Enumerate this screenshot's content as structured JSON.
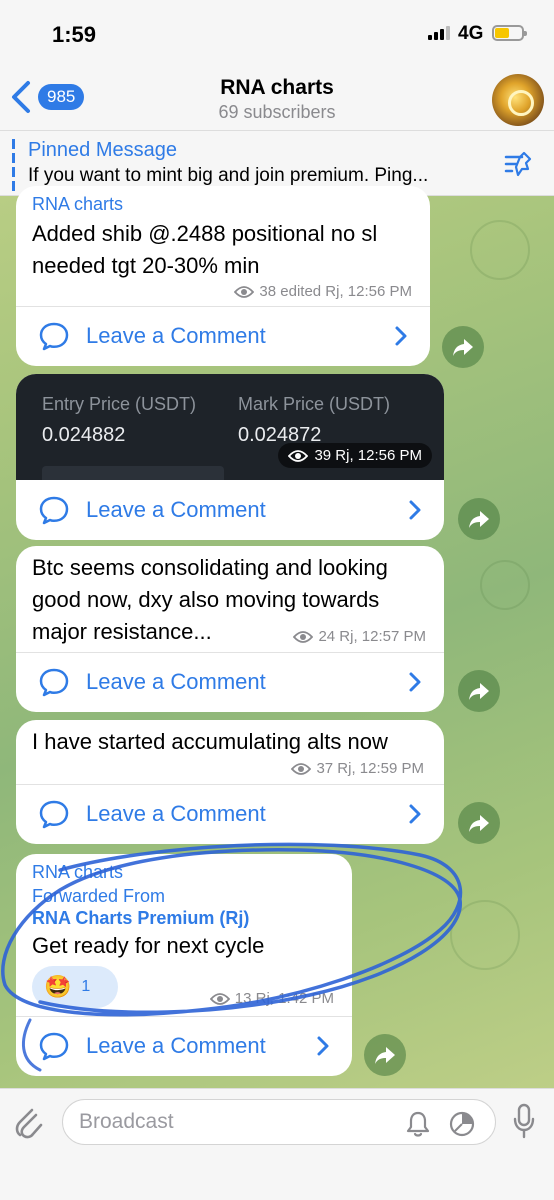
{
  "status_bar": {
    "time": "1:59",
    "network": "4G",
    "battery_level": 0.55
  },
  "header": {
    "back_count": "985",
    "title": "RNA charts",
    "subtitle": "69 subscribers"
  },
  "pinned": {
    "title": "Pinned Message",
    "text": "If you want to mint big and join premium.  Ping..."
  },
  "messages": [
    {
      "sender": "RNA charts",
      "text_lines": [
        "Added shib @.2488 positional no sl",
        "needed tgt 20-30% min"
      ],
      "meta": "38 edited Rj, 12:56 PM",
      "comment_label": "Leave a Comment"
    },
    {
      "card": {
        "entry_label": "Entry Price (USDT)",
        "entry_value": "0.024882",
        "mark_label": "Mark Price (USDT)",
        "mark_value": "0.024872"
      },
      "meta": "39 Rj, 12:56 PM",
      "comment_label": "Leave a Comment"
    },
    {
      "text_lines": [
        "Btc seems consolidating and looking",
        "good now, dxy also moving towards",
        "major resistance..."
      ],
      "meta": "24 Rj, 12:57 PM",
      "comment_label": "Leave a Comment"
    },
    {
      "text_lines": [
        "I have started accumulating alts now"
      ],
      "meta": "37 Rj, 12:59 PM",
      "comment_label": "Leave a Comment"
    },
    {
      "sender": "RNA charts",
      "forwarded_label": "Forwarded From",
      "forwarded_source": "RNA Charts Premium (Rj)",
      "text_lines": [
        "Get ready for next cycle"
      ],
      "reaction": {
        "emoji": "🤩",
        "count": "1"
      },
      "meta": "13 Rj, 1:42 PM",
      "comment_label": "Leave a Comment"
    }
  ],
  "input": {
    "placeholder": "Broadcast"
  },
  "colors": {
    "accent": "#2f7be6",
    "bubble": "#ffffff",
    "card_bg": "#1e2329",
    "scribble": "#2e63d6"
  },
  "icons": [
    "back-chevron-icon",
    "unpin-icon",
    "eye-icon",
    "comment-bubble-icon",
    "chevron-right-icon",
    "share-icon",
    "paperclip-icon",
    "bell-icon",
    "timer-icon",
    "microphone-icon"
  ]
}
